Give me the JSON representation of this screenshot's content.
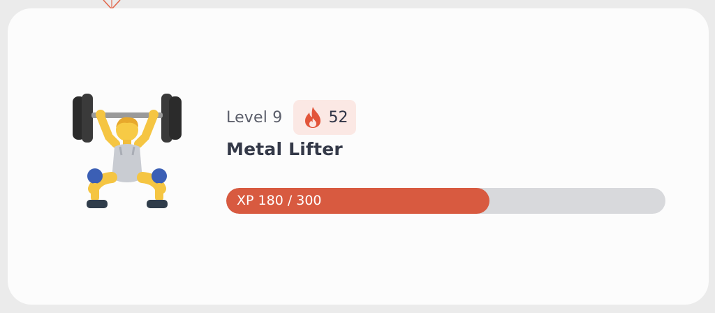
{
  "profile": {
    "avatar_icon": "weightlifter-icon",
    "level_label": "Level 9",
    "streak": {
      "icon": "flame-icon",
      "count": "52"
    },
    "title": "Metal Lifter",
    "xp": {
      "label": "XP 180 / 300",
      "current": 180,
      "max": 300
    }
  },
  "colors": {
    "accent": "#d85a40",
    "streak_badge_bg": "#fbe8e4",
    "track": "#d8d9dc",
    "card": "#fcfcfc",
    "page_bg": "#ebebeb"
  }
}
